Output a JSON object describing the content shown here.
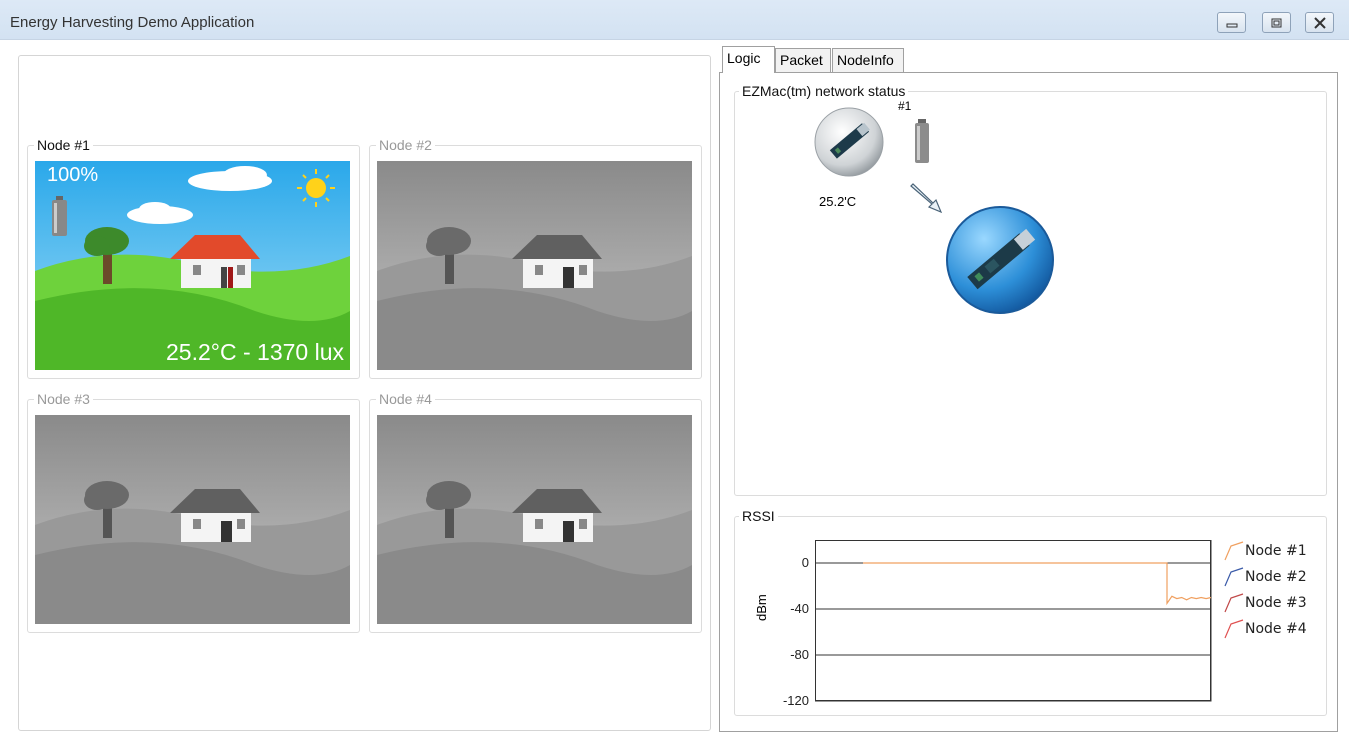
{
  "window": {
    "title": "Energy Harvesting Demo Application"
  },
  "nodes": [
    {
      "label": "Node #1",
      "active": true,
      "battery": "100%",
      "reading": "25.2°C - 1370 lux"
    },
    {
      "label": "Node #2",
      "active": false
    },
    {
      "label": "Node #3",
      "active": false
    },
    {
      "label": "Node #4",
      "active": false
    }
  ],
  "tabs": [
    {
      "label": "Logic",
      "active": true
    },
    {
      "label": "Packet",
      "active": false
    },
    {
      "label": "NodeInfo",
      "active": false
    }
  ],
  "network_status": {
    "title": "EZMac(tm) network status",
    "node_label": "#1",
    "temperature": "25.2'C"
  },
  "rssi": {
    "title": "RSSI",
    "chart_data": {
      "type": "line",
      "ylabel": "dBm",
      "ylim": [
        -120,
        20
      ],
      "yticks": [
        "0",
        "-40",
        "-80",
        "-120"
      ],
      "series": [
        {
          "name": "Node #1",
          "color": "#f0a060",
          "values": [
            0,
            0,
            0,
            0,
            0,
            0,
            -35,
            -29,
            -31,
            -30,
            -32,
            -30,
            -31,
            -30,
            -31,
            -30
          ]
        },
        {
          "name": "Node #2",
          "color": "#3a5aa8",
          "values": []
        },
        {
          "name": "Node #3",
          "color": "#c04848",
          "values": []
        },
        {
          "name": "Node #4",
          "color": "#e05050",
          "values": []
        }
      ]
    }
  },
  "colors": {
    "sky": "#3fb3ec",
    "grass": "#5bc72f",
    "roof": "#e24a2b"
  }
}
